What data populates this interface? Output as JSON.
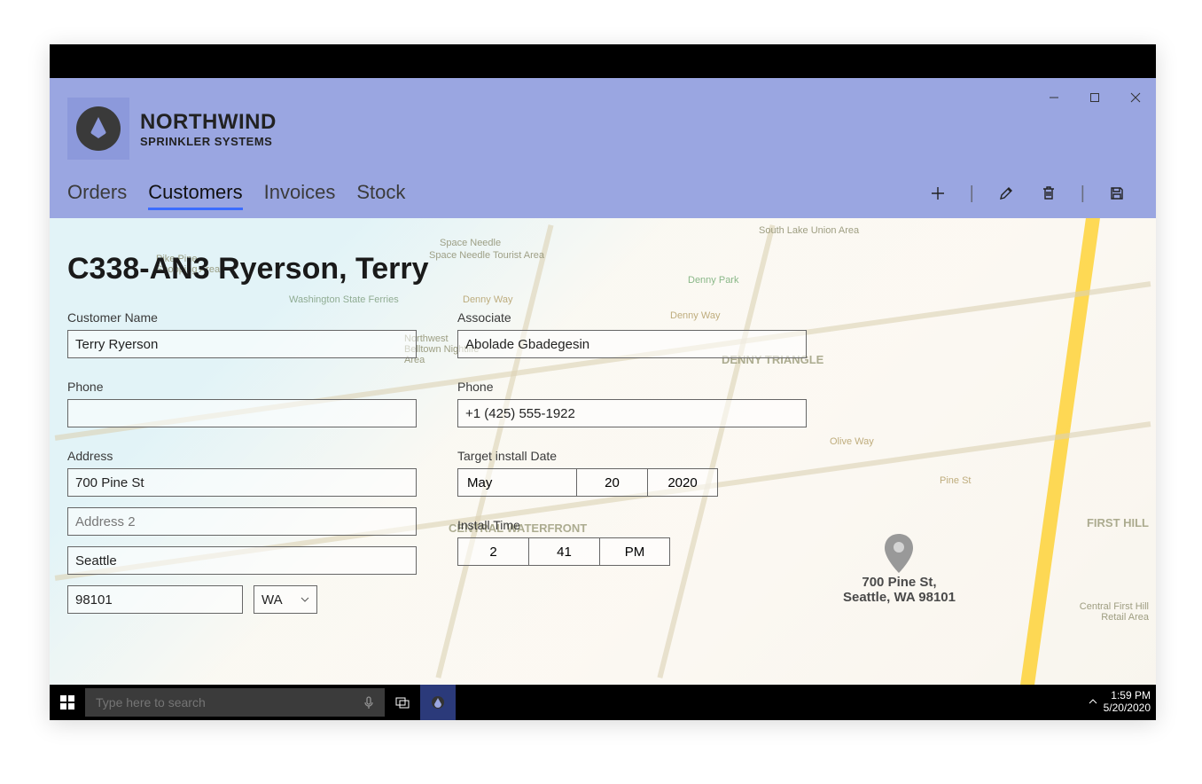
{
  "brand": {
    "line1": "NORTHWIND",
    "line2": "SPRINKLER SYSTEMS"
  },
  "tabs": {
    "orders": "Orders",
    "customers": "Customers",
    "invoices": "Invoices",
    "stock": "Stock"
  },
  "page": {
    "title": "C338-AN3 Ryerson, Terry"
  },
  "labels": {
    "customer_name": "Customer Name",
    "phone": "Phone",
    "address": "Address",
    "associate": "Associate",
    "associate_phone": "Phone",
    "target_install_date": "Target install Date",
    "install_time": "Install Time",
    "address2_placeholder": "Address 2"
  },
  "customer": {
    "name": "Terry Ryerson",
    "phone": "",
    "address1": "700 Pine St",
    "address2": "",
    "city": "Seattle",
    "zip": "98101",
    "state": "WA"
  },
  "associate": {
    "name": "Abolade Gbadegesin",
    "phone": "+1 (425) 555-1922"
  },
  "install_date": {
    "month": "May",
    "day": "20",
    "year": "2020"
  },
  "install_time": {
    "hour": "2",
    "minute": "41",
    "ampm": "PM"
  },
  "map_pin": {
    "line1": "700 Pine St,",
    "line2": "Seattle, WA 98101"
  },
  "map_labels": {
    "space_needle": "Space Needle",
    "space_needle_tourist": "Space Needle Tourist Area",
    "denny_triangle": "DENNY TRIANGLE",
    "denny_park": "Denny Park",
    "central_waterfront": "CENTRAL WATERFRONT",
    "south_lake": "South Lake Union Area",
    "first_hill": "FIRST HILL",
    "capitol_hill": "Central First Hill Retail Area",
    "washington_ferries": "Washington State Ferries",
    "pike_pine": "Pike Pine Shopping Area",
    "belltown": "Northwest Belltown Nightlife Area",
    "pine_st": "Pine St",
    "olive_way": "Olive Way",
    "denny_way": "Denny Way",
    "denny_way2": "Denny Way"
  },
  "taskbar": {
    "search_placeholder": "Type here to search",
    "time": "1:59 PM",
    "date": "5/20/2020"
  }
}
